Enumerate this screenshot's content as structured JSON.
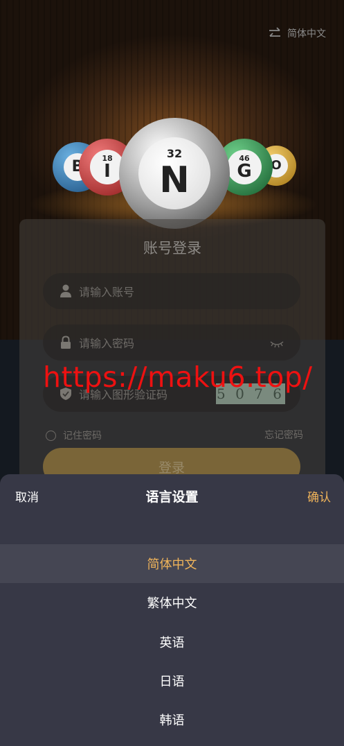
{
  "header": {
    "language": "简体中文",
    "switch_icon": "swap-arrows-icon"
  },
  "balls": [
    {
      "letter": "B",
      "number": ""
    },
    {
      "letter": "I",
      "number": "18"
    },
    {
      "letter": "N",
      "number": "32"
    },
    {
      "letter": "G",
      "number": "46"
    },
    {
      "letter": "O",
      "number": ""
    }
  ],
  "login": {
    "title": "账号登录",
    "account_placeholder": "请输入账号",
    "password_placeholder": "请输入密码",
    "captcha_placeholder": "请输入图形验证码",
    "captcha_text": "5 0 7 6",
    "remember_label": "记住密码",
    "forgot_label": "忘记密码",
    "login_label": "登录"
  },
  "watermark": "https://maku6.top/",
  "language_sheet": {
    "cancel_label": "取消",
    "title": "语言设置",
    "confirm_label": "确认",
    "options": [
      "简体中文",
      "繁体中文",
      "英语",
      "日语",
      "韩语"
    ],
    "selected": "简体中文"
  },
  "colors": {
    "accent": "#f0b45a",
    "sheet_bg": "#373846",
    "selected_row": "#454653"
  }
}
